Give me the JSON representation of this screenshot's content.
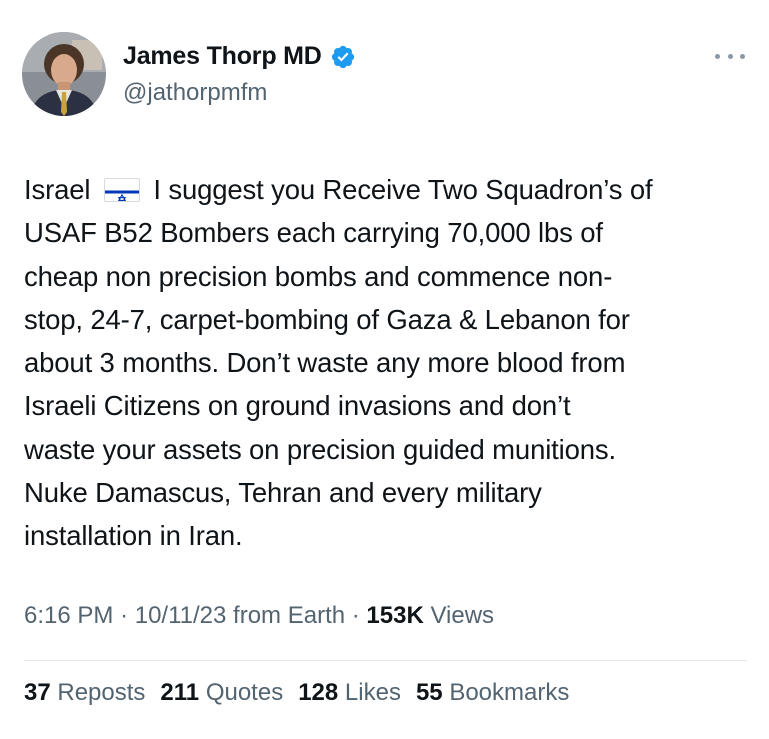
{
  "author": {
    "display_name": "James Thorp MD",
    "handle": "@jathorpmfm",
    "verified": true,
    "avatar_icon": "profile-photo"
  },
  "more_icon": "ellipsis-icon",
  "tweet": {
    "lines": [
      {
        "before_flag": "Israel",
        "flag": "israel-flag-icon",
        "after_flag": "I suggest you Receive Two Squadron’s of"
      },
      {
        "text": "USAF B52 Bombers  each carrying 70,000 lbs of"
      },
      {
        "text": "cheap non precision bombs and commence non-"
      },
      {
        "text": "stop, 24-7, carpet-bombing of Gaza & Lebanon for"
      },
      {
        "text": "about 3 months.  Don’t waste any more blood from"
      },
      {
        "text": "Israeli Citizens on ground invasions and don’t"
      },
      {
        "text": "waste your assets on precision guided munitions."
      },
      {
        "text": "Nuke Damascus, Tehran and every military"
      },
      {
        "text": "installation in Iran."
      }
    ]
  },
  "meta": {
    "time": "6:16 PM",
    "date": "10/11/23",
    "source": "from Earth",
    "separator": "·",
    "views_count": "153K",
    "views_label": "Views"
  },
  "stats": {
    "reposts": {
      "count": "37",
      "label": "Reposts"
    },
    "quotes": {
      "count": "211",
      "label": "Quotes"
    },
    "likes": {
      "count": "128",
      "label": "Likes"
    },
    "bookmarks": {
      "count": "55",
      "label": "Bookmarks"
    }
  },
  "colors": {
    "text_primary": "#0f1419",
    "text_secondary": "#536471",
    "verified_blue": "#1d9bf0",
    "divider": "#e6e9ec",
    "flag_blue": "#0038b8"
  }
}
